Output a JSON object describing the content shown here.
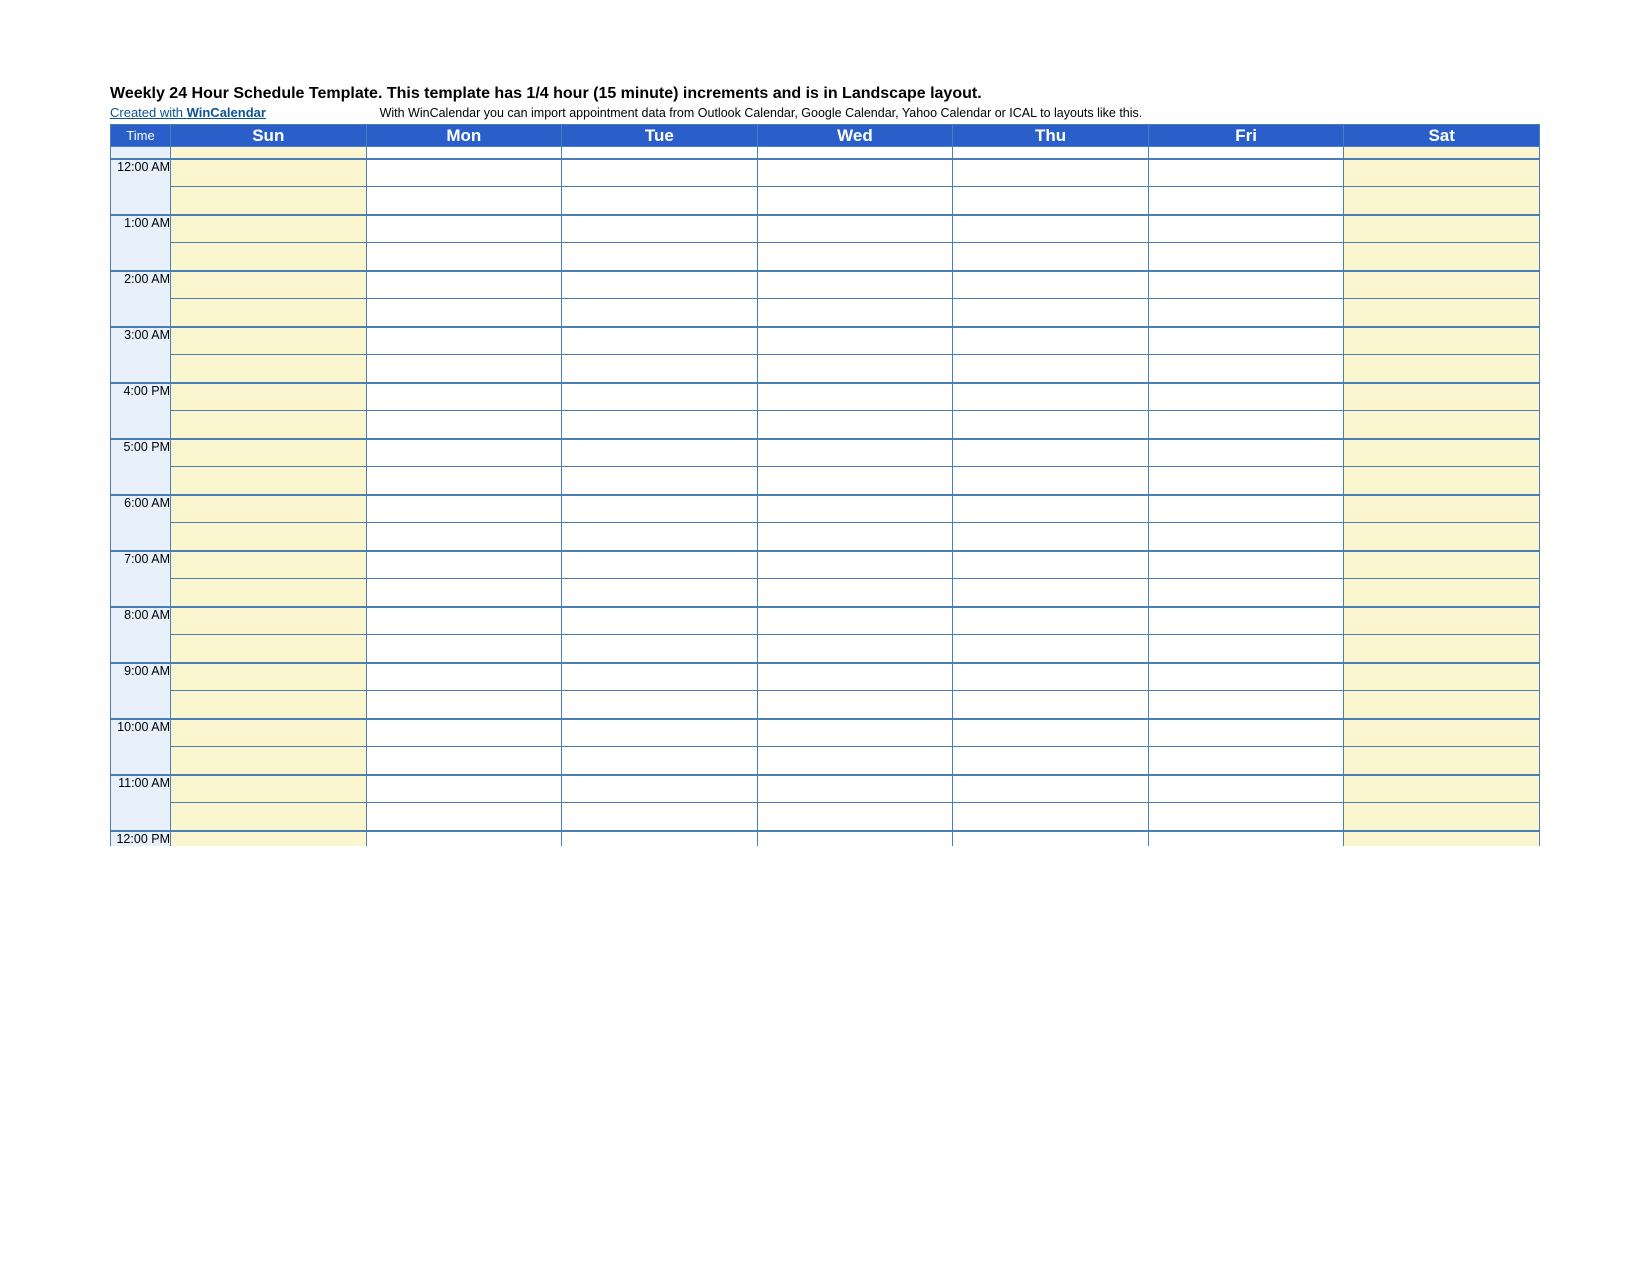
{
  "header": {
    "title": "Weekly 24 Hour Schedule Template.  This template has 1/4 hour (15 minute) increments and is in Landscape layout.",
    "created_prefix": "Created with ",
    "created_link": "WinCalendar",
    "subnote": "With WinCalendar you can import appointment data from Outlook Calendar, Google Calendar, Yahoo Calendar or ICAL to layouts like this."
  },
  "columns": {
    "time": "Time",
    "days": [
      "Sun",
      "Mon",
      "Tue",
      "Wed",
      "Thu",
      "Fri",
      "Sat"
    ]
  },
  "hours": [
    "12:00 AM",
    "1:00 AM",
    "2:00 AM",
    "3:00 AM",
    "4:00 PM",
    "5:00 PM",
    "6:00 AM",
    "7:00 AM",
    "8:00 AM",
    "9:00 AM",
    "10:00 AM",
    "11:00 AM",
    "12:00 PM"
  ]
}
